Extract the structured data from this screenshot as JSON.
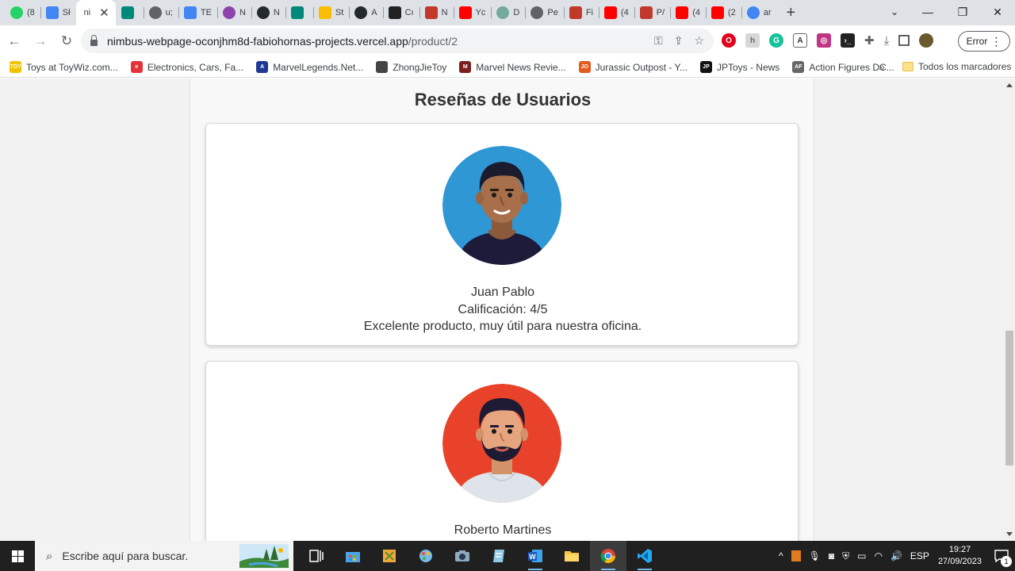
{
  "browser": {
    "tabs": [
      {
        "label": "(8",
        "icon": "whatsapp-icon",
        "color": "#25d366"
      },
      {
        "label": "Sł",
        "icon": "google-docs-icon",
        "color": "#4285f4"
      },
      {
        "label": "ni",
        "icon": "",
        "color": "",
        "active": true
      },
      {
        "label": "",
        "icon": "google-meet-icon",
        "color": "#00897b"
      },
      {
        "label": "u;",
        "icon": "globe-icon",
        "color": "#5f6368"
      },
      {
        "label": "TE",
        "icon": "google-docs-icon",
        "color": "#4285f4"
      },
      {
        "label": "N",
        "icon": "clockify-icon",
        "color": "#8e44ad"
      },
      {
        "label": "N",
        "icon": "github-icon",
        "color": "#24292e"
      },
      {
        "label": "",
        "icon": "google-meet-icon",
        "color": "#00897b"
      },
      {
        "label": "St",
        "icon": "notes-icon",
        "color": "#fbbc04"
      },
      {
        "label": "A",
        "icon": "github-icon",
        "color": "#24292e"
      },
      {
        "label": "Cı",
        "icon": "chart-icon",
        "color": "#222222"
      },
      {
        "label": "N",
        "icon": "store-icon",
        "color": "#c0392b"
      },
      {
        "label": "Yc",
        "icon": "youtube-icon",
        "color": "#ff0000"
      },
      {
        "label": "D",
        "icon": "openai-icon",
        "color": "#74aa9c"
      },
      {
        "label": "Pe",
        "icon": "globe-icon",
        "color": "#5f6368"
      },
      {
        "label": "Fi",
        "icon": "store-icon",
        "color": "#c0392b"
      },
      {
        "label": "(4",
        "icon": "youtube-icon",
        "color": "#ff0000"
      },
      {
        "label": "P/",
        "icon": "store-icon",
        "color": "#c0392b"
      },
      {
        "label": "(4",
        "icon": "youtube-icon",
        "color": "#ff0000"
      },
      {
        "label": "(2",
        "icon": "youtube-icon",
        "color": "#ff0000"
      },
      {
        "label": "ar",
        "icon": "google-icon",
        "color": "#4285f4"
      }
    ],
    "new_tab": "+",
    "url_host": "nimbus-webpage-oconjhm8d-fabiohornas-projects.vercel.app",
    "url_path": "/product/2",
    "profile_button": "Error",
    "bookmarks": [
      {
        "label": "Toys at ToyWiz.com...",
        "icon": "toywiz-icon",
        "color": "#f2c200",
        "text": "TOY"
      },
      {
        "label": "Electronics, Cars, Fa...",
        "icon": "ebay-icon",
        "color": "#e53238",
        "text": "e"
      },
      {
        "label": "MarvelLegends.Net...",
        "icon": "avengers-icon",
        "color": "#1f3a93",
        "text": "A"
      },
      {
        "label": "ZhongJieToy",
        "icon": "globe-icon",
        "color": "#444444",
        "text": ""
      },
      {
        "label": "Marvel News Revie...",
        "icon": "marvel-icon",
        "color": "#7a1f1f",
        "text": "M"
      },
      {
        "label": "Jurassic Outpost - Y...",
        "icon": "jurassic-icon",
        "color": "#e35b1e",
        "text": "JO"
      },
      {
        "label": "JPToys - News",
        "icon": "jptoys-icon",
        "color": "#111111",
        "text": "JP"
      },
      {
        "label": "Action Figures DC...",
        "icon": "dc-icon",
        "color": "#666666",
        "text": "AF"
      }
    ],
    "bookmarks_more": "»",
    "all_bookmarks": "Todos los marcadores"
  },
  "page": {
    "section_title": "Reseñas de Usuarios",
    "reviews": [
      {
        "name": "Juan Pablo",
        "rating": "Calificación: 4/5",
        "comment": "Excelente producto, muy útil para nuestra oficina.",
        "avatar_bg": "#2f97d4"
      },
      {
        "name": "Roberto Martines",
        "avatar_bg": "#e8432a"
      }
    ]
  },
  "taskbar": {
    "search_placeholder": "Escribe aquí para buscar.",
    "language": "ESP",
    "time": "19:27",
    "date": "27/09/2023",
    "notifications": "1"
  }
}
